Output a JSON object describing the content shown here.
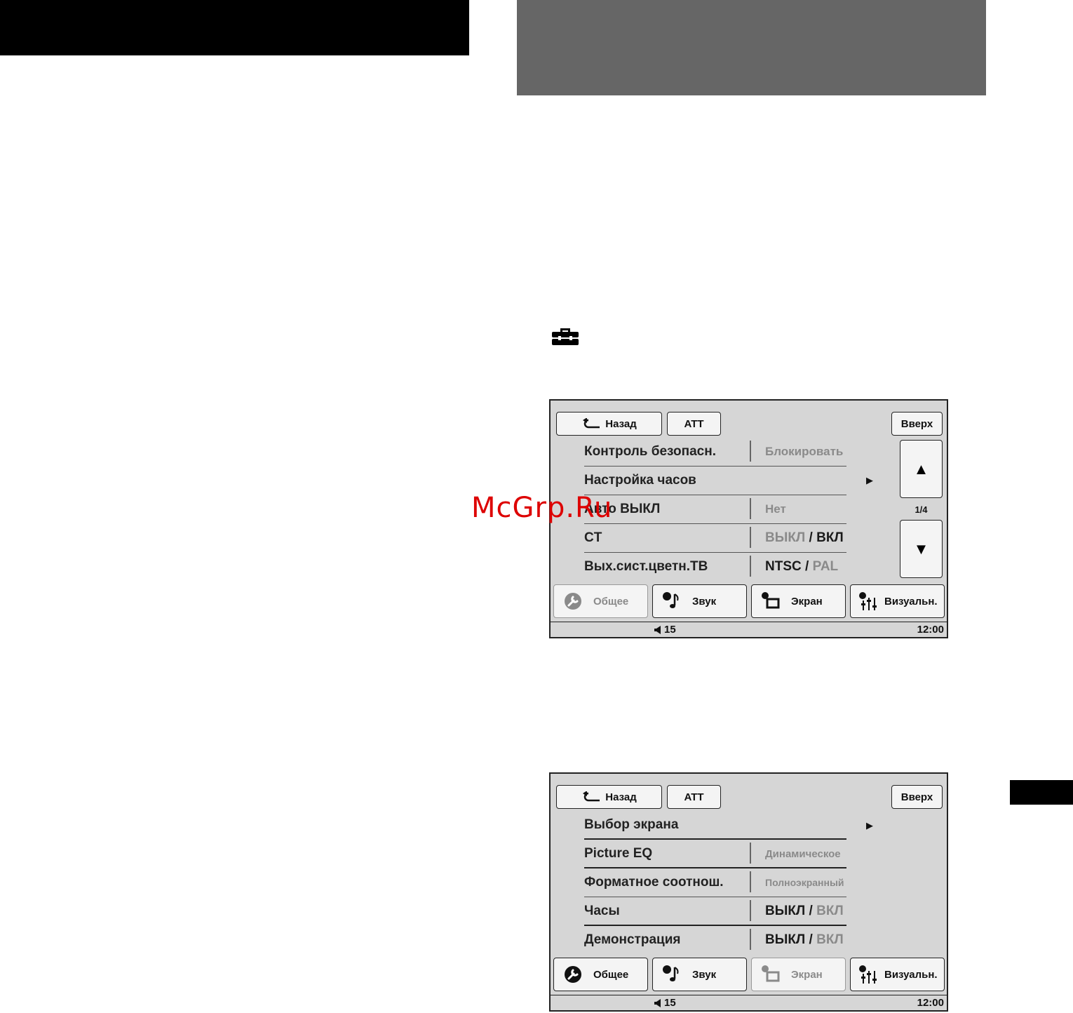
{
  "watermark": "McGrp.Ru",
  "icons": {
    "toolbox": "toolbox-icon"
  },
  "screen1": {
    "back_label": "Назад",
    "att_label": "ATT",
    "top_label": "Вверх",
    "page_indicator": "1/4",
    "rows": [
      {
        "label": "Контроль безопасн.",
        "value": "Блокировать"
      },
      {
        "label": "Настройка часов"
      },
      {
        "label": "Авто ВЫКЛ",
        "value": "Нет"
      },
      {
        "label": "CT",
        "value_a": "ВЫКЛ",
        "slash": "/",
        "value_b": "ВКЛ"
      },
      {
        "label": "Вых.сист.цветн.ТВ",
        "value_a": "NTSC",
        "slash": "/",
        "value_b": "PAL"
      }
    ],
    "tabs": [
      "Общее",
      "Звук",
      "Экран",
      "Визуальн."
    ],
    "active_tab": "Общее",
    "volume": "15",
    "clock": "12:00"
  },
  "screen2": {
    "back_label": "Назад",
    "att_label": "ATT",
    "top_label": "Вверх",
    "rows": [
      {
        "label": "Выбор экрана"
      },
      {
        "label": "Picture EQ",
        "value": "Динамическое"
      },
      {
        "label": "Форматное соотнош.",
        "value": "Полноэкранный"
      },
      {
        "label": "Часы",
        "value_a": "ВЫКЛ",
        "slash": "/",
        "value_b": "ВКЛ"
      },
      {
        "label": "Демонстрация",
        "value_a": "ВЫКЛ",
        "slash": "/",
        "value_b": "ВКЛ"
      }
    ],
    "tabs": [
      "Общее",
      "Звук",
      "Экран",
      "Визуальн."
    ],
    "active_tab": "Экран",
    "volume": "15",
    "clock": "12:00"
  },
  "colors": {
    "screen_bg": "#d6d6d6",
    "dim_text": "#8a8a8a",
    "header_gray": "#666666"
  }
}
